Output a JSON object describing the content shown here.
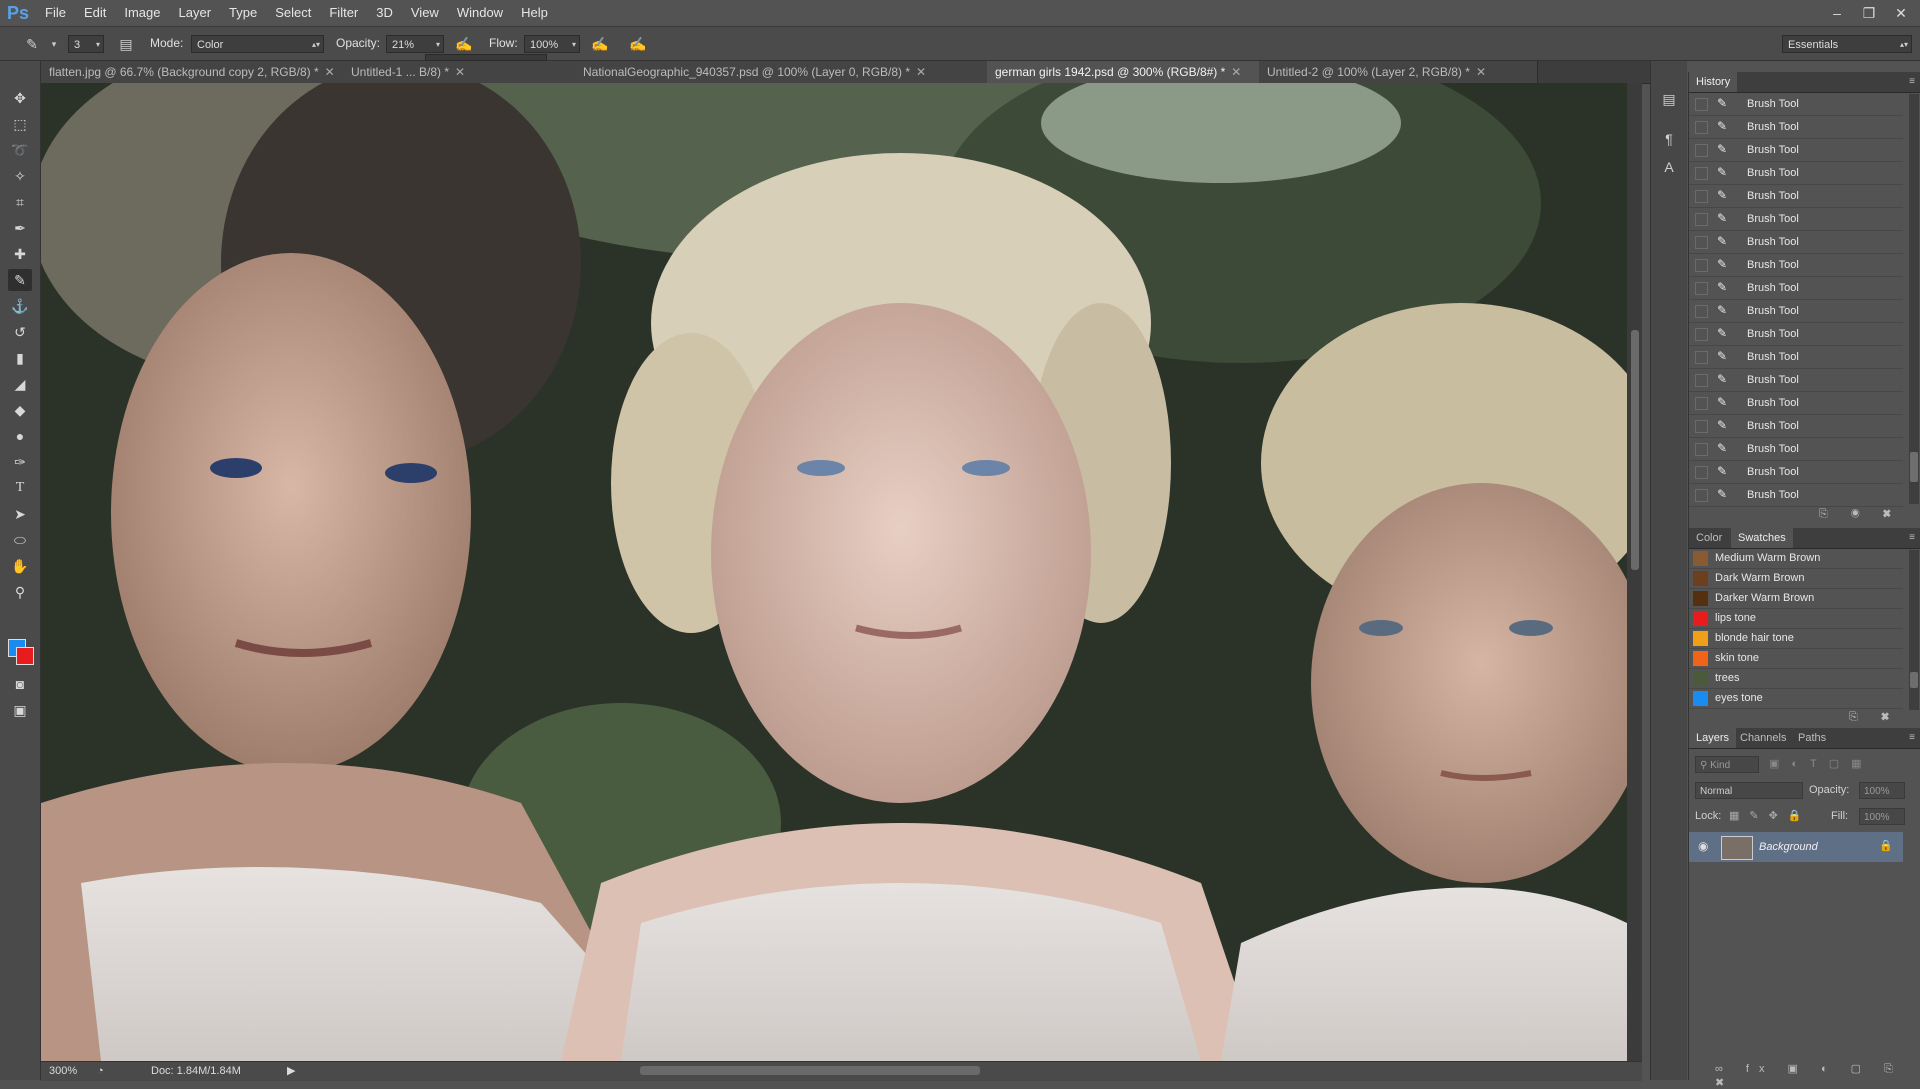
{
  "app": {
    "logo": "Ps"
  },
  "menubar": {
    "items": [
      "File",
      "Edit",
      "Image",
      "Layer",
      "Type",
      "Select",
      "Filter",
      "3D",
      "View",
      "Window",
      "Help"
    ],
    "window_controls": [
      "minimize",
      "restore",
      "close"
    ]
  },
  "options": {
    "brush_size": "3",
    "mode_label": "Mode:",
    "mode_value": "Color",
    "opacity_label": "Opacity:",
    "opacity_value": "21%",
    "flow_label": "Flow:",
    "flow_value": "100%",
    "workspace": "Essentials"
  },
  "tabs": [
    {
      "label": "flatten.jpg @ 66.7% (Background copy 2, RGB/8) *",
      "active": false
    },
    {
      "label": "Untitled-1 ... B/8) *",
      "active": false
    },
    {
      "label": "NationalGeographic_940357.psd @ 100% (Layer 0, RGB/8) *",
      "active": false
    },
    {
      "label": "german girls 1942.psd @ 300% (RGB/8#) *",
      "active": true
    },
    {
      "label": "Untitled-2 @ 100% (Layer 2, RGB/8) *",
      "active": false
    }
  ],
  "status": {
    "zoom": "300%",
    "doc": "Doc: 1.84M/1.84M"
  },
  "history": {
    "title": "History",
    "items": [
      "Brush Tool",
      "Brush Tool",
      "Brush Tool",
      "Brush Tool",
      "Brush Tool",
      "Brush Tool",
      "Brush Tool",
      "Brush Tool",
      "Brush Tool",
      "Brush Tool",
      "Brush Tool",
      "Brush Tool",
      "Brush Tool",
      "Brush Tool",
      "Brush Tool",
      "Brush Tool",
      "Brush Tool",
      "Brush Tool"
    ]
  },
  "swatches_panel": {
    "tabs": [
      "Color",
      "Swatches"
    ],
    "items": [
      {
        "name": "Medium Warm Brown",
        "color": "#8a5a32"
      },
      {
        "name": "Dark Warm Brown",
        "color": "#6e3f1e"
      },
      {
        "name": "Darker Warm Brown",
        "color": "#55300f"
      },
      {
        "name": "lips tone",
        "color": "#e81c1c"
      },
      {
        "name": "blonde hair tone",
        "color": "#f0a018"
      },
      {
        "name": "skin tone",
        "color": "#f06418"
      },
      {
        "name": "trees",
        "color": "#4a5a3a"
      },
      {
        "name": "eyes tone",
        "color": "#1a8cf0"
      }
    ]
  },
  "layers_panel": {
    "tabs": [
      "Layers",
      "Channels",
      "Paths"
    ],
    "kind_label": "Kind",
    "blend_mode": "Normal",
    "opacity_label": "Opacity:",
    "opacity_value": "100%",
    "lock_label": "Lock:",
    "fill_label": "Fill:",
    "fill_value": "100%",
    "layers": [
      {
        "name": "Background",
        "visible": true,
        "locked": true
      }
    ]
  },
  "colors": {
    "foreground": "#1a8cf0",
    "background": "#e81c1c"
  }
}
